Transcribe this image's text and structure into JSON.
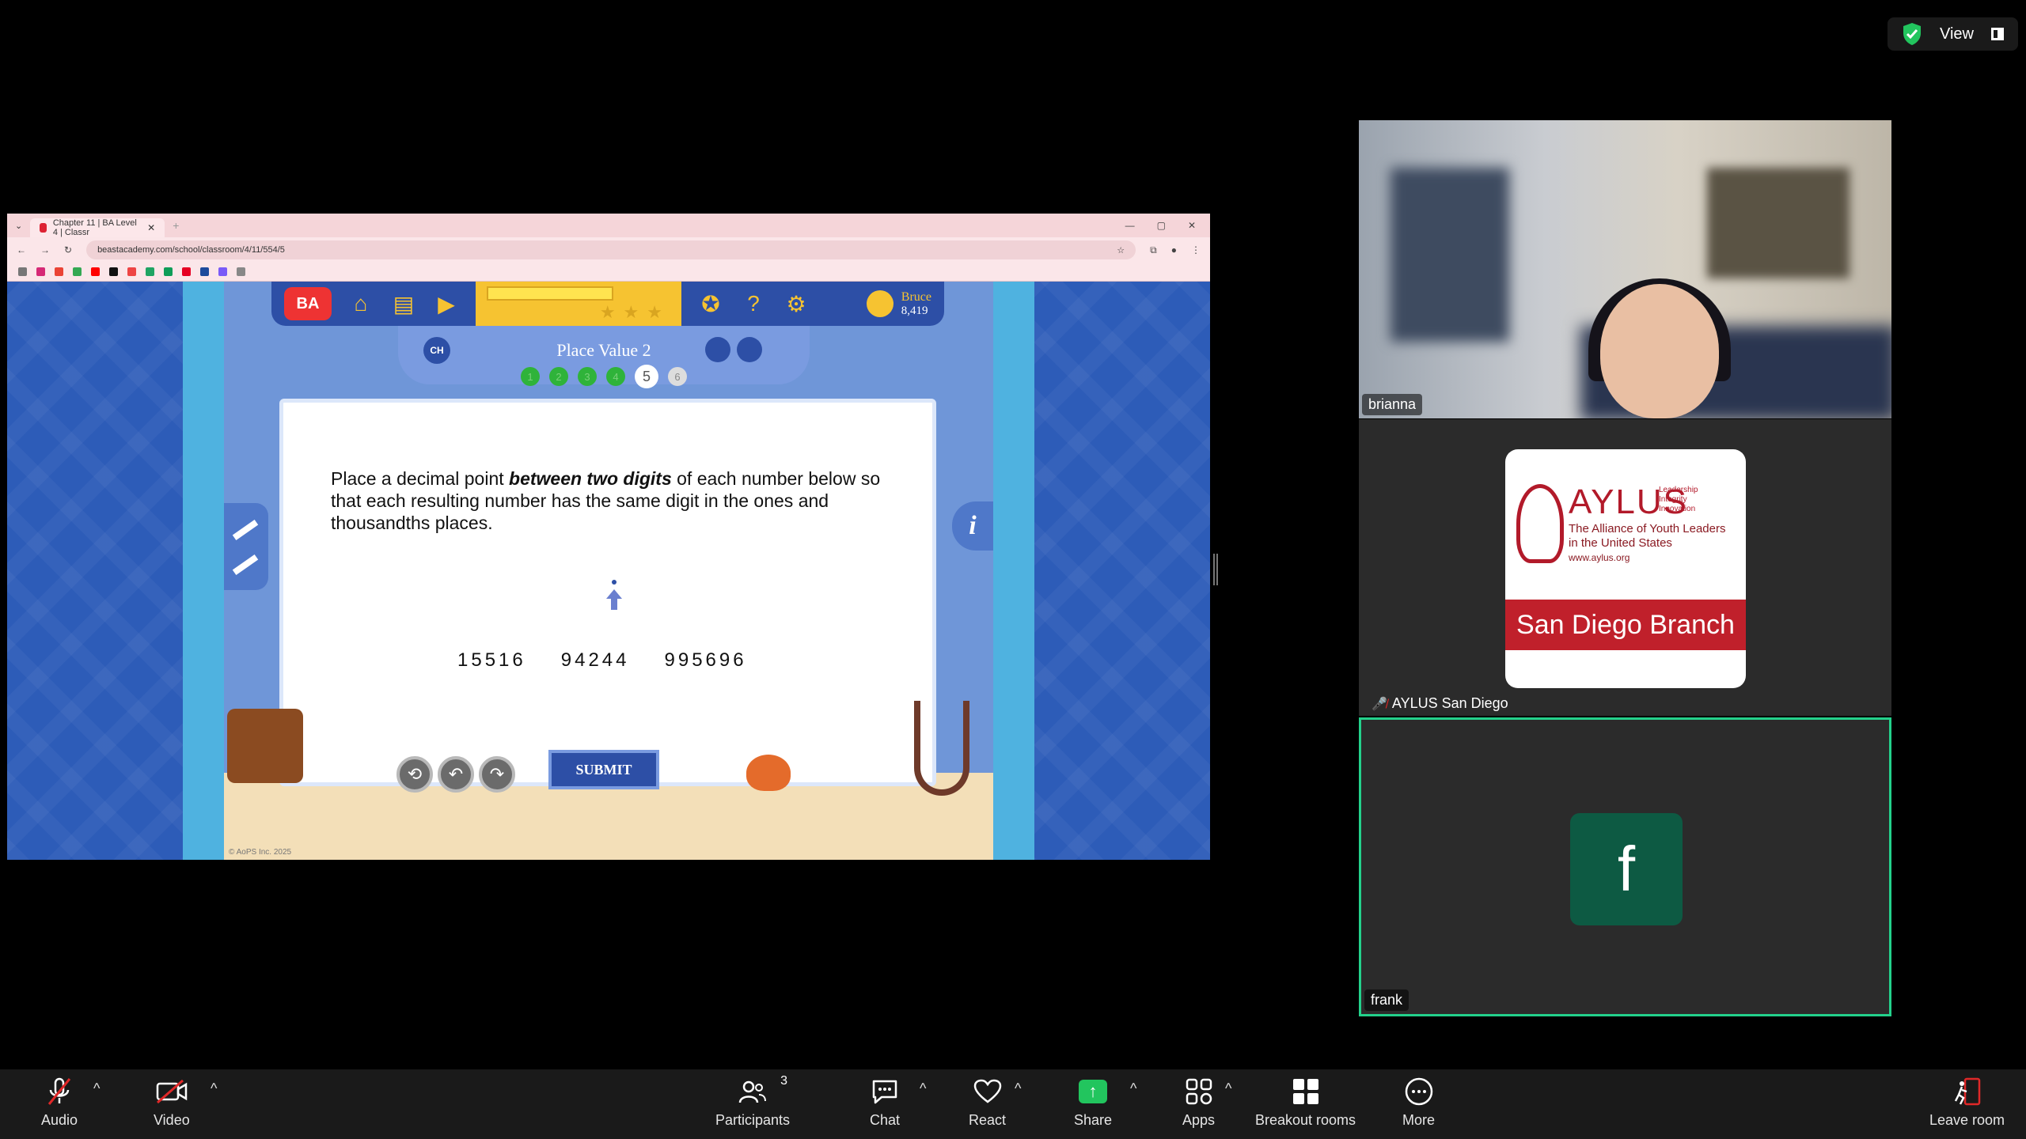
{
  "topbar": {
    "view_label": "View"
  },
  "browser": {
    "tab_title": "Chapter 11 | BA Level 4 | Classr",
    "url": "beastacademy.com/school/classroom/4/11/554/5"
  },
  "game": {
    "user_name": "Bruce",
    "user_points": "8,419",
    "chapter_badge": "CH",
    "page_title": "Place Value 2",
    "progress_dots": [
      "1",
      "2",
      "3",
      "4",
      "5",
      "6"
    ],
    "current_step": 5,
    "question_part1": "Place a decimal point ",
    "question_bold": "between two digits",
    "question_part2": " of each number below so that each resulting number has the same digit in the ones and thousandths places.",
    "numbers": [
      "15516",
      "94244",
      "995696"
    ],
    "submit_label": "SUBMIT",
    "info_label": "i",
    "copyright": "© AoPS Inc. 2025"
  },
  "participants_tiles": [
    {
      "name": "brianna"
    },
    {
      "name": "AYLUS San Diego",
      "muted": true
    },
    {
      "name": "frank",
      "avatar_letter": "f"
    }
  ],
  "aylus_logo": {
    "name": "AYLUS",
    "motto": [
      "Leadership",
      "Integrity",
      "Innovation"
    ],
    "full_name_line1": "The Alliance of Youth Leaders",
    "full_name_line2": "in the United States",
    "url": "www.aylus.org",
    "branch": "San Diego Branch"
  },
  "toolbar": {
    "audio": "Audio",
    "video": "Video",
    "participants": "Participants",
    "participants_count": "3",
    "chat": "Chat",
    "react": "React",
    "share": "Share",
    "apps": "Apps",
    "breakout": "Breakout rooms",
    "more": "More",
    "leave": "Leave room"
  },
  "colors": {
    "active_speaker_border": "#23d18b",
    "share_green": "#22c55e",
    "aylus_red": "#c0202b",
    "frank_avatar": "#0d5a43"
  }
}
